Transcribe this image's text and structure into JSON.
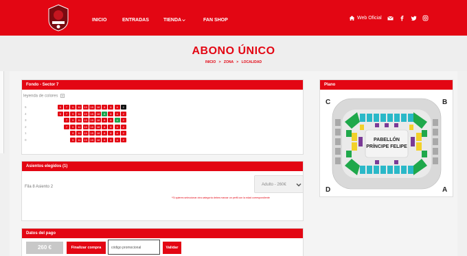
{
  "header": {
    "nav": [
      "INICIO",
      "ENTRADAS",
      "TIENDA",
      "FAN SHOP"
    ],
    "web_oficial": "Web Oficial"
  },
  "page": {
    "title": "ABONO ÚNICO",
    "breadcrumb": [
      "INICIO",
      "ZONA",
      "LOCALIDAD"
    ]
  },
  "sector_panel": {
    "title": "Fondo - Sector 7",
    "legend": "leyenda de colores",
    "rows": [
      {
        "label": "6",
        "seats": [
          "5",
          "7",
          "9",
          "11",
          "13",
          "15",
          "18",
          "8",
          "6",
          "4",
          "2"
        ],
        "colors": [
          "r",
          "r",
          "r",
          "r",
          "r",
          "r",
          "r",
          "r",
          "r",
          "r",
          "k"
        ]
      },
      {
        "label": "4",
        "seats": [
          "5",
          "7",
          "9",
          "11",
          "13",
          "15",
          "18",
          "8",
          "6",
          "4",
          "2"
        ],
        "colors": [
          "r",
          "r",
          "r",
          "r",
          "r",
          "r",
          "r",
          "g",
          "r",
          "r",
          "r"
        ]
      },
      {
        "label": "3",
        "seats": [
          "7",
          "9",
          "11",
          "13",
          "15",
          "18",
          "8",
          "6",
          "4",
          "2"
        ],
        "colors": [
          "r",
          "r",
          "r",
          "r",
          "r",
          "r",
          "r",
          "r",
          "g",
          "r"
        ]
      },
      {
        "label": "2",
        "seats": [
          "7",
          "9",
          "11",
          "13",
          "15",
          "18",
          "8",
          "6",
          "4",
          "2"
        ],
        "colors": [
          "r",
          "r",
          "r",
          "r",
          "r",
          "r",
          "r",
          "r",
          "r",
          "r"
        ]
      },
      {
        "label": "1",
        "seats": [
          "9",
          "11",
          "13",
          "15",
          "18",
          "8",
          "6",
          "4",
          "2"
        ],
        "colors": [
          "r",
          "r",
          "r",
          "r",
          "r",
          "r",
          "r",
          "r",
          "r"
        ]
      },
      {
        "label": "0",
        "seats": [
          "9",
          "11",
          "13",
          "15",
          "18",
          "8",
          "6",
          "4",
          "2"
        ],
        "colors": [
          "r",
          "r",
          "r",
          "r",
          "r",
          "r",
          "r",
          "r",
          "r"
        ]
      }
    ]
  },
  "selected_panel": {
    "title": "Asientos elegidos (1)",
    "seat_text": "Fila 8 Asiento 2",
    "select_value": "Adulto - 260€",
    "note": "*Si quieres seleccionar otra categoría debes marcar un perfil con la edad correspondiente"
  },
  "payment_panel": {
    "title": "Datos del pago",
    "price": "260 €",
    "finalize": "Finalizar compra",
    "promo_placeholder": "código promocional",
    "validate": "Validar"
  },
  "plan_panel": {
    "title": "Plano",
    "venue_line1": "PABELLÓN",
    "venue_line2": "PRÍNCIPE FELIPE",
    "corners": [
      "C",
      "B",
      "D",
      "A"
    ]
  },
  "colors": {
    "brand": "#e30613",
    "available_green": "#1aa34a"
  }
}
